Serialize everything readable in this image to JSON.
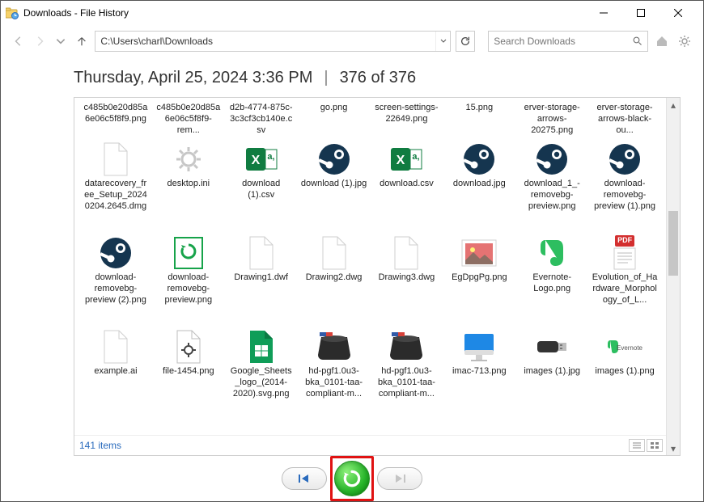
{
  "window": {
    "title": "Downloads - File History"
  },
  "toolbar": {
    "path": "C:\\Users\\charl\\Downloads",
    "search_placeholder": "Search Downloads"
  },
  "heading": {
    "timestamp": "Thursday, April 25, 2024 3:36 PM",
    "position": "376 of 376"
  },
  "truncated_row": [
    "c485b0e20d85a6e06c5f8f9.png",
    "c485b0e20d85a6e06c5f8f9-rem...",
    "d2b-4774-875c-3c3cf3cb140e.csv",
    "go.png",
    "screen-settings-22649.png",
    "15.png",
    "erver-storage-arrows-20275.png",
    "erver-storage-arrows-black-ou..."
  ],
  "rows": [
    [
      {
        "name": "datarecovery_free_Setup_20240204.2645.dmg",
        "icon": "blank"
      },
      {
        "name": "desktop.ini",
        "icon": "gear"
      },
      {
        "name": "download (1).csv",
        "icon": "excel"
      },
      {
        "name": "download (1).jpg",
        "icon": "steam"
      },
      {
        "name": "download.csv",
        "icon": "excel"
      },
      {
        "name": "download.jpg",
        "icon": "steam"
      },
      {
        "name": "download_1_-removebg-preview.png",
        "icon": "steam"
      },
      {
        "name": "download-removebg-preview (1).png",
        "icon": "steam"
      }
    ],
    [
      {
        "name": "download-removebg-preview (2).png",
        "icon": "steam"
      },
      {
        "name": "download-removebg-preview.png",
        "icon": "refresh-green"
      },
      {
        "name": "Drawing1.dwf",
        "icon": "blank"
      },
      {
        "name": "Drawing2.dwg",
        "icon": "blank"
      },
      {
        "name": "Drawing3.dwg",
        "icon": "blank"
      },
      {
        "name": "EgDpgPg.png",
        "icon": "photo"
      },
      {
        "name": "Evernote-Logo.png",
        "icon": "evernote"
      },
      {
        "name": "Evolution_of_Hardware_Morphology_of_L...",
        "icon": "pdf"
      }
    ],
    [
      {
        "name": "example.ai",
        "icon": "blank"
      },
      {
        "name": "file-1454.png",
        "icon": "gear-doc"
      },
      {
        "name": "Google_Sheets_logo_(2014-2020).svg.png",
        "icon": "sheets"
      },
      {
        "name": "hd-pgf1.0u3-bka_0101-taa-compliant-m...",
        "icon": "hdd"
      },
      {
        "name": "hd-pgf1.0u3-bka_0101-taa-compliant-m...",
        "icon": "hdd"
      },
      {
        "name": "imac-713.png",
        "icon": "imac"
      },
      {
        "name": "images (1).jpg",
        "icon": "usb"
      },
      {
        "name": "images (1).png",
        "icon": "evernote-wide"
      }
    ]
  ],
  "status": {
    "count_label": "141 items"
  },
  "controls": {
    "prev": "previous-version",
    "restore": "restore",
    "next": "next-version"
  },
  "icon_palette": {
    "steam": "#1b2838",
    "excel": "#107c41",
    "pdf": "#d32f2f",
    "evernote": "#2dbe60",
    "imac": "#1e88e5",
    "sheets": "#0f9d58"
  }
}
